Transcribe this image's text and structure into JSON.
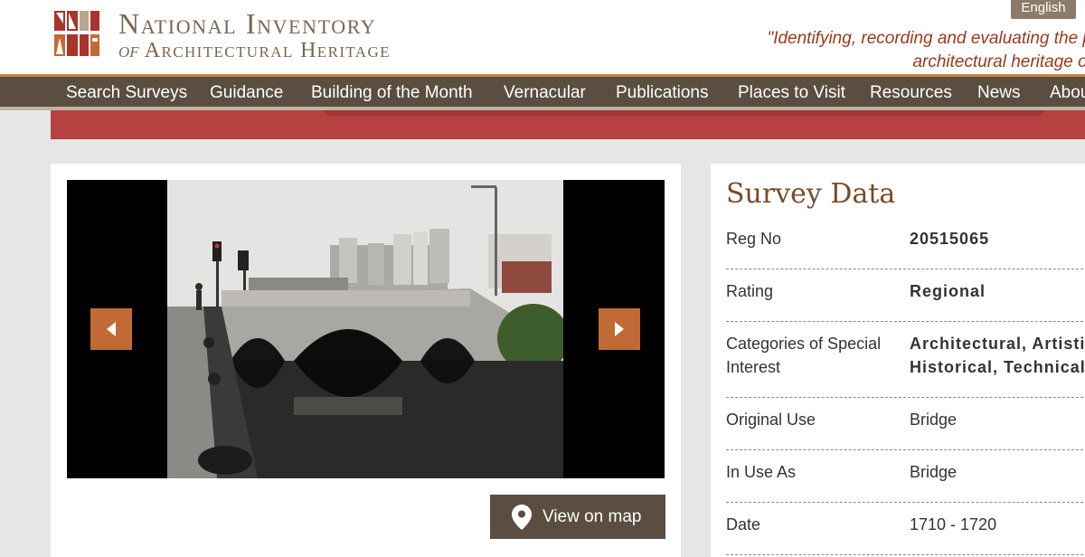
{
  "header": {
    "title_line1": "National Inventory",
    "title_line2_prefix": "of",
    "title_line2_rest": "Architectural Heritage",
    "tagline_line1": "\"Identifying, recording and evaluating the p",
    "tagline_line2": "architectural heritage of",
    "language_button": "English"
  },
  "nav": {
    "items": [
      "Search Surveys",
      "Guidance",
      "Building of the Month",
      "Vernacular",
      "Publications",
      "Places to Visit",
      "Resources",
      "News",
      "Abou"
    ]
  },
  "viewer": {
    "prev_icon": "chevron-left-icon",
    "next_icon": "chevron-right-icon",
    "map_button": "View on map",
    "map_icon": "map-pin-icon"
  },
  "survey": {
    "title": "Survey Data",
    "rows": [
      {
        "label": "Reg No",
        "value": "20515065"
      },
      {
        "label": "Rating",
        "value": "Regional"
      },
      {
        "label": "Categories of Special Interest",
        "value_line1": "Architectural, Artistic",
        "value_line2": "Historical, Technical"
      },
      {
        "label": "Original Use",
        "value": "Bridge"
      },
      {
        "label": "In Use As",
        "value": "Bridge"
      },
      {
        "label": "Date",
        "value": "1710 - 1720"
      }
    ]
  },
  "colors": {
    "nav_bg": "#5b4d40",
    "accent_orange": "#c26a35",
    "banner_red": "#b54141",
    "title_brown": "#7a4a26",
    "tagline_red": "#9a3a1c"
  }
}
